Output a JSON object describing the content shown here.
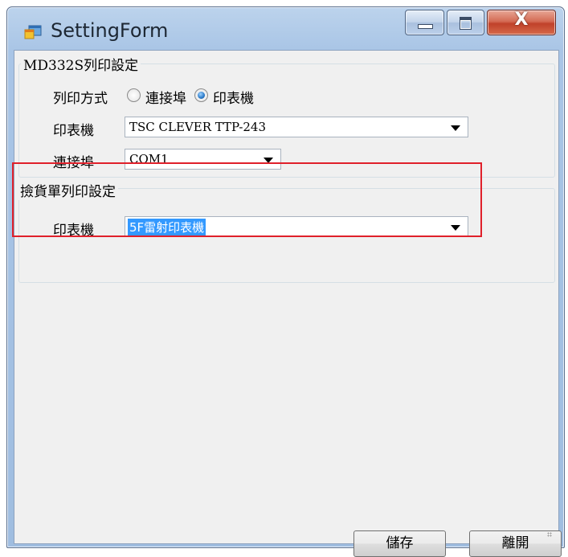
{
  "window": {
    "title": "SettingForm",
    "close_glyph": "X"
  },
  "group1": {
    "title": "MD332S列印設定",
    "print_mode_label": "列印方式",
    "options": [
      {
        "label": "連接埠",
        "checked": false
      },
      {
        "label": "印表機",
        "checked": true
      }
    ],
    "printer_label": "印表機",
    "printer_value": "TSC CLEVER TTP-243",
    "port_label": "連接埠",
    "port_value": "COM1"
  },
  "group2": {
    "title": "撿貨單列印設定",
    "printer_label": "印表機",
    "printer_value": "5F雷射印表機"
  },
  "buttons": {
    "save": "儲存",
    "exit": "離開"
  },
  "colors": {
    "highlight_border": "#e0202a",
    "selection": "#3399ff",
    "client_bg": "#f0f0f0"
  },
  "icons": [
    "app-icon",
    "minimize-icon",
    "maximize-icon",
    "close-icon",
    "chevron-down-icon",
    "resize-grip-icon"
  ]
}
